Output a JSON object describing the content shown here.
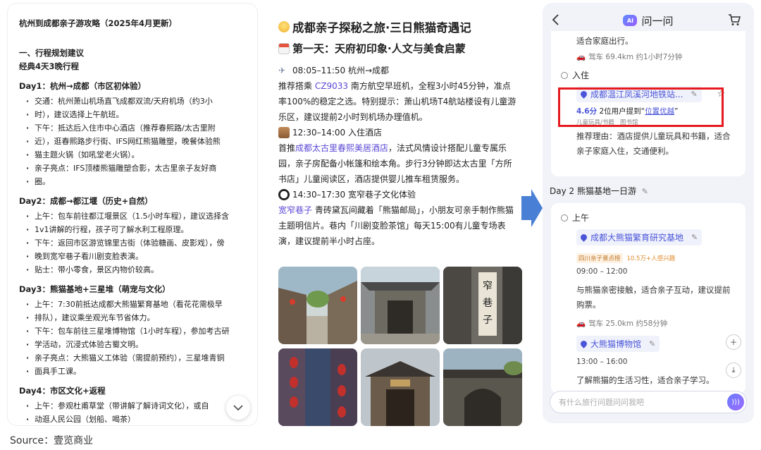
{
  "panel1": {
    "title": "杭州到成都亲子游攻略（2025年4月更新）",
    "section_heading": "一、行程规划建议",
    "subheading": "经典4天3晚行程",
    "days": [
      {
        "title": "Day1：杭州→成都（市区初体验）",
        "items": [
          "交通：杭州萧山机场直飞成都双流/天府机场（约3小",
          "时），建议选择上午航班。",
          "下午：抵达后入住市中心酒店（推荐春熙路/太古里附",
          "近），逛春熙路步行街、IFS网红熊猫雕塑，晚餐体验熊",
          "猫主题火锅（如吼堂老火锅）。",
          "亲子亮点：IFS顶楼熊猫雕塑合影，太古里亲子友好商",
          "圈。"
        ]
      },
      {
        "title": "Day2：成都→都江堰（历史+自然）",
        "items": [
          "上午：包车前往都江堰景区（1.5小时车程），建议选择含",
          "1v1讲解的行程，孩子可了解水利工程原理。",
          "下午：返回市区游览锦里古街（体验糖画、皮影戏），傍",
          "晚到宽窄巷子看川剧变脸表演。",
          "贴士：带小零食，景区内物价较高。"
        ]
      },
      {
        "title": "Day3：熊猫基地+三星堆（萌宠与文化）",
        "items": [
          "上午：7:30前抵达成都大熊猫繁育基地（看花花需极早",
          "排队），建议乘坐观光车节省体力。",
          "下午：包车前往三星堆博物馆（1小时车程），参加考古研",
          "学活动，沉浸式体验古蜀文明。",
          "亲子亮点：大熊猫义工体验（需提前预约），三星堆青铜",
          "面具手工课。"
        ]
      },
      {
        "title": "Day4：市区文化+返程",
        "items": [
          "上午：参观杜甫草堂（带讲解了解诗词文化），或自",
          "动逛人民公园（划船、喝茶）"
        ]
      }
    ],
    "scroll_button": "⌄"
  },
  "panel2": {
    "title": "成都亲子探秘之旅·三日熊猫奇遇记",
    "day1": "第一天：天府初印象·人文与美食启蒙",
    "flight_time": "08:05–11:50 杭州→成都",
    "flight_pre": "推荐搭乘",
    "flight_no": "CZ9033",
    "flight_post": "南方航空早班机，全程3小时45分钟，准点率100%的稳定之选。特别提示：萧山机场T4航站楼设有儿童游乐区，建议提前2小时到机场办理值机。",
    "hotel_time": "12:30–14:00 入住酒店",
    "hotel_pre": "首推",
    "hotel_name": "成都太古里春熙美居酒店",
    "hotel_post": "，法式风情设计搭配儿童专属乐园，亲子房配备小帐篷和绘本角。步行3分钟即达太古里「方所书店」儿童阅读区，酒店提供婴儿推车租赁服务。",
    "alley_time": "14:30–17:30 宽窄巷子文化体验",
    "alley_name": "宽窄巷子",
    "alley_post": "青砖黛瓦间藏着「熊猫邮局」，小朋友可亲手制作熊猫主题明信片。巷内「川剧变脸茶馆」每天15:00有儿童专场表演，建议提前半小时占座。"
  },
  "panel3": {
    "header_title": "问一问",
    "ai_badge": "AI",
    "top_text": "适合家庭出行。",
    "drive1": "驾车 69.4km 约1小时7分钟",
    "checkin_label": "入住",
    "hotel_chip": "成都温江凤溪河地铁站...",
    "rating": "4.6分",
    "rating_note_pre": "2位用户提到“",
    "rating_note_link": "位置优越",
    "rating_note_post": "”",
    "hotel_tags": "儿童玩具/书籍   图书馆",
    "hotel_reason": "推荐理由：酒店提供儿童玩具和书籍，适合亲子家庭入住，交通便利。",
    "day2_title": "Day 2 熊猫基地一日游",
    "morning_label": "上午",
    "poi1": "成都大熊猫繁育研究基地",
    "poi1_tag1": "四川亲子景点榜",
    "poi1_tag2": "10.5万+人感兴趣",
    "poi1_time": "09:00 – 12:00",
    "poi1_desc": "与熊猫亲密接触，适合亲子互动，建议提前购票。",
    "drive2": "驾车 25.0km 约58分钟",
    "poi2": "大熊猫博物馆",
    "poi2_time": "13:00 – 16:00",
    "poi2_desc": "了解熊猫的生活习性，适合亲子学习。",
    "input_placeholder": "有什么旅行问题问问我吧"
  },
  "source": "Source：壹览商业",
  "colors": {
    "accent": "#4a55d8",
    "highlight_box": "#e5191e",
    "arrow": "#4a7fd6"
  }
}
